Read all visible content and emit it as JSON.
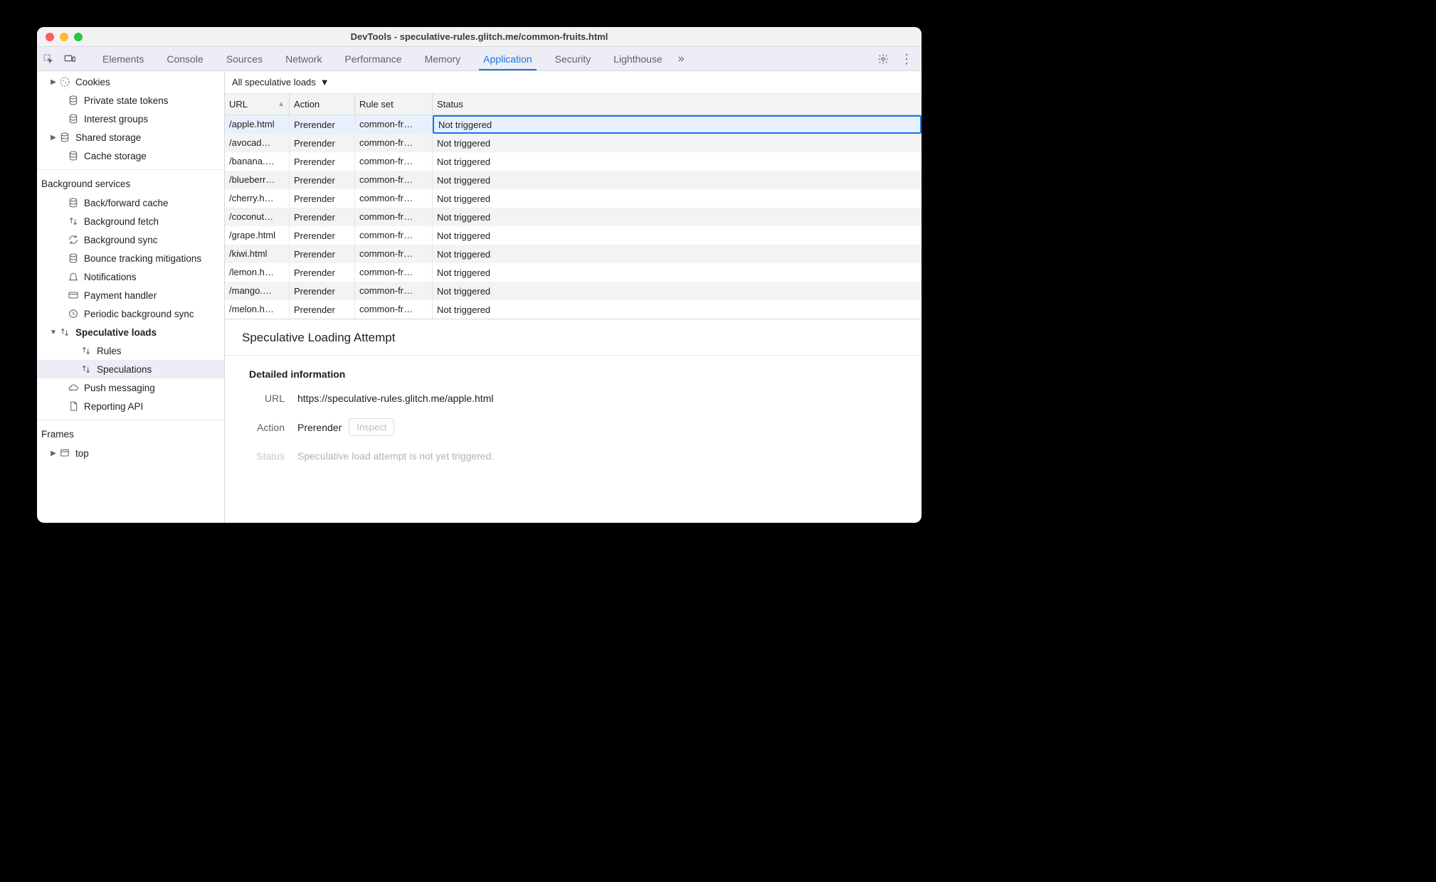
{
  "window": {
    "title": "DevTools - speculative-rules.glitch.me/common-fruits.html"
  },
  "tabs": {
    "items": [
      "Elements",
      "Console",
      "Sources",
      "Network",
      "Performance",
      "Memory",
      "Application",
      "Security",
      "Lighthouse"
    ],
    "active": "Application"
  },
  "sidebar": {
    "storage_items": [
      {
        "label": "Cookies",
        "icon": "cookie",
        "arrow": true,
        "indent": 18
      },
      {
        "label": "Private state tokens",
        "icon": "db",
        "indent": 30
      },
      {
        "label": "Interest groups",
        "icon": "db",
        "indent": 30
      },
      {
        "label": "Shared storage",
        "icon": "db",
        "arrow": true,
        "indent": 18
      },
      {
        "label": "Cache storage",
        "icon": "db",
        "indent": 30
      }
    ],
    "bg_header": "Background services",
    "bg_items": [
      {
        "label": "Back/forward cache",
        "icon": "db",
        "indent": 30
      },
      {
        "label": "Background fetch",
        "icon": "updown",
        "indent": 30
      },
      {
        "label": "Background sync",
        "icon": "sync",
        "indent": 30
      },
      {
        "label": "Bounce tracking mitigations",
        "icon": "db",
        "indent": 30
      },
      {
        "label": "Notifications",
        "icon": "bell",
        "indent": 30
      },
      {
        "label": "Payment handler",
        "icon": "card",
        "indent": 30
      },
      {
        "label": "Periodic background sync",
        "icon": "clock",
        "indent": 30
      },
      {
        "label": "Speculative loads",
        "icon": "updown",
        "indent": 18,
        "arrow": true,
        "expanded": true,
        "bold": true
      },
      {
        "label": "Rules",
        "icon": "updown",
        "indent": 48
      },
      {
        "label": "Speculations",
        "icon": "updown",
        "indent": 48,
        "selected": true
      },
      {
        "label": "Push messaging",
        "icon": "cloud",
        "indent": 30
      },
      {
        "label": "Reporting API",
        "icon": "page",
        "indent": 30
      }
    ],
    "frames_header": "Frames",
    "frames_items": [
      {
        "label": "top",
        "icon": "frame",
        "arrow": true,
        "indent": 18
      }
    ]
  },
  "filter": {
    "label": "All speculative loads"
  },
  "table": {
    "columns": [
      "URL",
      "Action",
      "Rule set",
      "Status"
    ],
    "rows": [
      {
        "url": "/apple.html",
        "action": "Prerender",
        "ruleset": "common-fr…",
        "status": "Not triggered",
        "selected": true
      },
      {
        "url": "/avocad…",
        "action": "Prerender",
        "ruleset": "common-fr…",
        "status": "Not triggered"
      },
      {
        "url": "/banana.…",
        "action": "Prerender",
        "ruleset": "common-fr…",
        "status": "Not triggered"
      },
      {
        "url": "/blueberr…",
        "action": "Prerender",
        "ruleset": "common-fr…",
        "status": "Not triggered"
      },
      {
        "url": "/cherry.h…",
        "action": "Prerender",
        "ruleset": "common-fr…",
        "status": "Not triggered"
      },
      {
        "url": "/coconut…",
        "action": "Prerender",
        "ruleset": "common-fr…",
        "status": "Not triggered"
      },
      {
        "url": "/grape.html",
        "action": "Prerender",
        "ruleset": "common-fr…",
        "status": "Not triggered"
      },
      {
        "url": "/kiwi.html",
        "action": "Prerender",
        "ruleset": "common-fr…",
        "status": "Not triggered"
      },
      {
        "url": "/lemon.h…",
        "action": "Prerender",
        "ruleset": "common-fr…",
        "status": "Not triggered"
      },
      {
        "url": "/mango.…",
        "action": "Prerender",
        "ruleset": "common-fr…",
        "status": "Not triggered"
      },
      {
        "url": "/melon.h…",
        "action": "Prerender",
        "ruleset": "common-fr…",
        "status": "Not triggered"
      }
    ]
  },
  "details": {
    "title": "Speculative Loading Attempt",
    "subheader": "Detailed information",
    "url_label": "URL",
    "url_value": "https://speculative-rules.glitch.me/apple.html",
    "action_label": "Action",
    "action_value": "Prerender",
    "inspect_label": "Inspect",
    "status_label": "Status",
    "status_value": "Speculative load attempt is not yet triggered."
  }
}
